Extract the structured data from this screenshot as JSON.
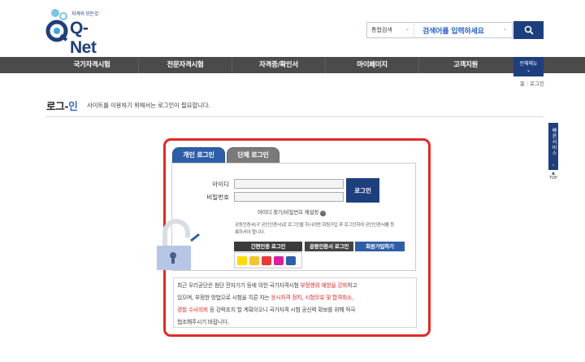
{
  "header": {
    "logo_tagline": "자격의 모든것",
    "logo_name": "Q-Net",
    "search_category": "통합검색",
    "search_placeholder": "검색어를 입력하세요",
    "search_button_icon": "search-icon"
  },
  "nav": {
    "items": [
      "국가자격시험",
      "전문자격시험",
      "자격증/확인서",
      "마이페이지",
      "고객지원"
    ],
    "all_menu": "전체메뉴"
  },
  "breadcrumb": {
    "home": "홈",
    "current": "로그인"
  },
  "page": {
    "title_a": "로그-",
    "title_b": "인",
    "subtitle": "사이트를 이용하기 위해서는 로그인이 필요합니다."
  },
  "quick": {
    "label": "빠른서비스",
    "top": "TOP"
  },
  "login": {
    "tab_personal": "개인 로그인",
    "tab_group": "단체 로그인",
    "id_label": "아이디",
    "pw_label": "비밀번호",
    "login_button": "로그인",
    "find_link": "아이디 찾기/비밀번호 재설정",
    "cert_notice": "공동인증서(구 공인인증서)로 로그인을 하시려면 회원가입 후 로그인하여 공인인증서를 등록하셔야 합니다.",
    "simple_cert_button": "간편인증 로그인",
    "joint_cert_button": "공동인증서 로그인",
    "join_button": "회원가입하기"
  },
  "notice": {
    "p1": "최근 우리공단은 첨단 전자기기 등에 의한 국가자격시험 ",
    "p1_red": "부정행위 예방을 강화",
    "p1b": "하고",
    "p2": "있으며, 부정한 방법으로 시험을 치른 자는 ",
    "p2_red": "응시자격 정지, 시험무효 및 합격취소,",
    "p3_red": "경찰 수사의뢰",
    "p3": " 등 강력조치 할 계획이오니 국가자격 시험 공신력 확보를 위해 적극",
    "p4": "협조해주시기 바랍니다."
  },
  "colors": {
    "navy": "#1e3f7e",
    "blue": "#2f5ea8",
    "red": "#e02a27",
    "nav": "#4b4b4b"
  }
}
